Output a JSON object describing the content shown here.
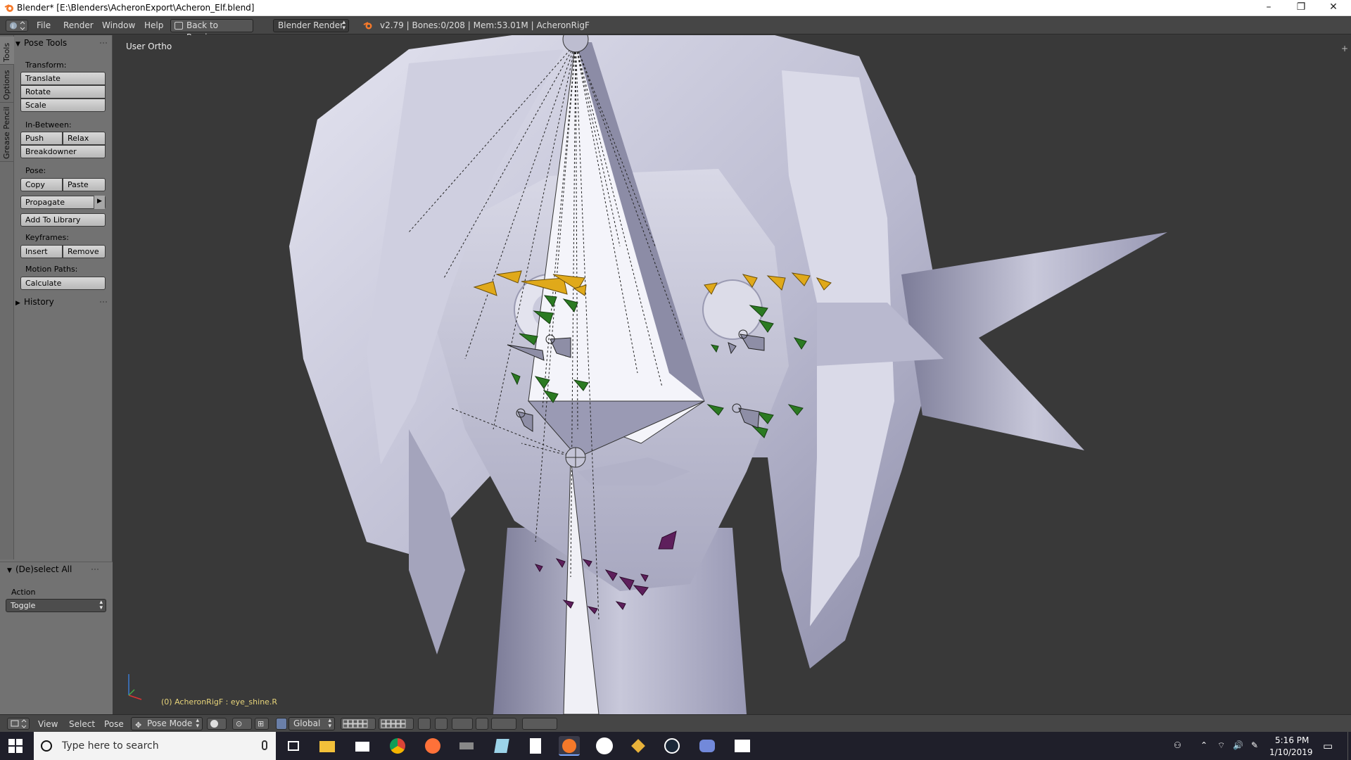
{
  "window": {
    "title": "Blender* [E:\\Blenders\\AcheronExport\\Acheron_Elf.blend]",
    "minimize": "–",
    "restore": "❐",
    "close": "✕"
  },
  "info_header": {
    "menus": [
      "File",
      "Render",
      "Window",
      "Help"
    ],
    "back_button": "Back to Previous",
    "engine": "Blender Render",
    "stats": "v2.79 | Bones:0/208 | Mem:53.01M | AcheronRigF"
  },
  "toolshelf": {
    "tabs": [
      "Tools",
      "Options",
      "Grease Pencil"
    ],
    "pose_tools": {
      "title": "Pose Tools",
      "transform_label": "Transform:",
      "translate": "Translate",
      "rotate": "Rotate",
      "scale": "Scale",
      "inbetween_label": "In-Between:",
      "push": "Push",
      "relax": "Relax",
      "breakdowner": "Breakdowner",
      "pose_label": "Pose:",
      "copy": "Copy",
      "paste": "Paste",
      "propagate": "Propagate",
      "add_to_library": "Add To Library",
      "keyframes_label": "Keyframes:",
      "insert": "Insert",
      "remove": "Remove",
      "motion_paths_label": "Motion Paths:",
      "calculate": "Calculate"
    },
    "history": "History"
  },
  "operator_panel": {
    "title": "(De)select All",
    "action_label": "Action",
    "action_value": "Toggle"
  },
  "viewport": {
    "view_label": "User Ortho",
    "object_label": "(0) AcheronRigF : eye_shine.R"
  },
  "footer": {
    "menus": [
      "View",
      "Select",
      "Pose"
    ],
    "mode": "Pose Mode",
    "orientation": "Global"
  },
  "taskbar": {
    "search_placeholder": "Type here to search",
    "time": "5:16 PM",
    "date": "1/10/2019"
  },
  "colors": {
    "bone_yellow": "#e0a91a",
    "bone_green": "#2b7a22",
    "bone_purple": "#5e1f5c",
    "mesh": "#c9c9dc",
    "viewport_bg": "#393939"
  }
}
